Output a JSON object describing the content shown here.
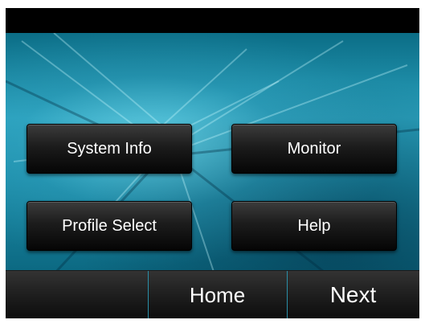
{
  "menu": {
    "system_info_label": "System Info",
    "monitor_label": "Monitor",
    "profile_select_label": "Profile Select",
    "help_label": "Help"
  },
  "softkeys": {
    "left_label": "",
    "home_label": "Home",
    "next_label": "Next"
  },
  "colors": {
    "background_accent": "#1d8eaa",
    "button_face": "#1c1c1c",
    "softkey_divider": "#2a8fa8"
  }
}
